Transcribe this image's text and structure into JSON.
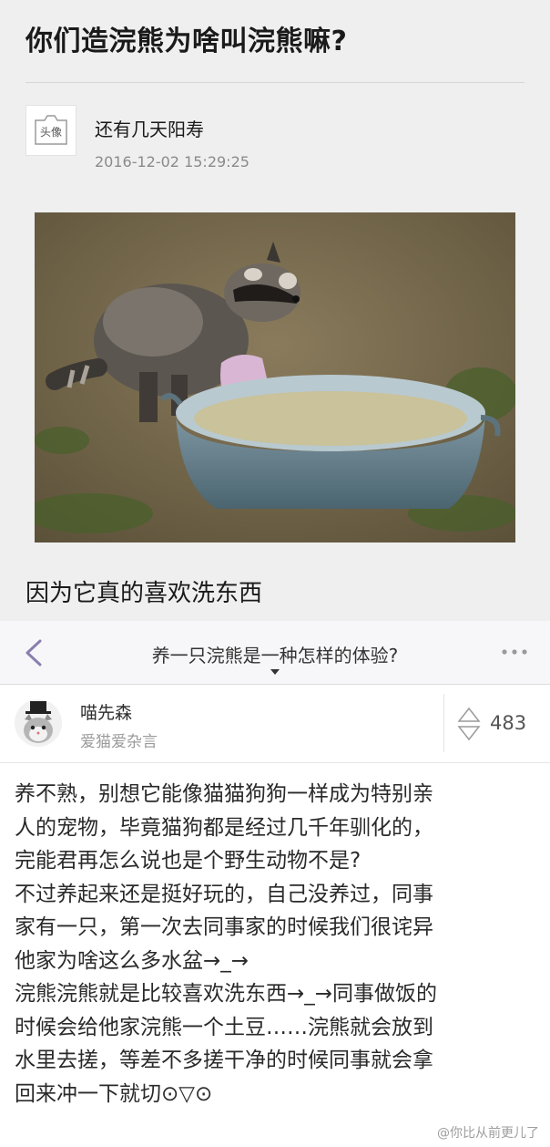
{
  "article": {
    "title": "你们造浣熊为啥叫浣熊嘛?",
    "avatar_text": "头像",
    "author": "还有几天阳寿",
    "timestamp": "2016-12-02 15:29:25",
    "caption": "因为它真的喜欢洗东西"
  },
  "question_bar": {
    "title": "养一只浣熊是一种怎样的体验?",
    "icons": {
      "back": "chevron-left-icon",
      "more": "more-dots-icon",
      "expand": "caret-down-icon"
    }
  },
  "answer": {
    "author_name": "喵先森",
    "author_bio": "爱猫爱杂言",
    "vote_count": "483",
    "lines": [
      "养不熟，别想它能像猫猫狗狗一样成为特别亲",
      "人的宠物，毕竟猫狗都是经过几千年驯化的，",
      "完能君再怎么说也是个野生动物不是?",
      "不过养起来还是挺好玩的，自己没养过，同事",
      "家有一只，第一次去同事家的时候我们很诧异",
      "他家为啥这么多水盆→_→",
      "浣熊浣熊就是比较喜欢洗东西→_→同事做饭的",
      "时候会给他家浣熊一个土豆……浣熊就会放到",
      "水里去搓，等差不多搓干净的时候同事就会拿",
      "回来冲一下就切⊙▽⊙"
    ]
  },
  "watermark": "@你比从前更儿了",
  "colors": {
    "accent": "#8a7fb0",
    "background_card": "#efefef",
    "nav_bg": "#f7f7f9"
  }
}
